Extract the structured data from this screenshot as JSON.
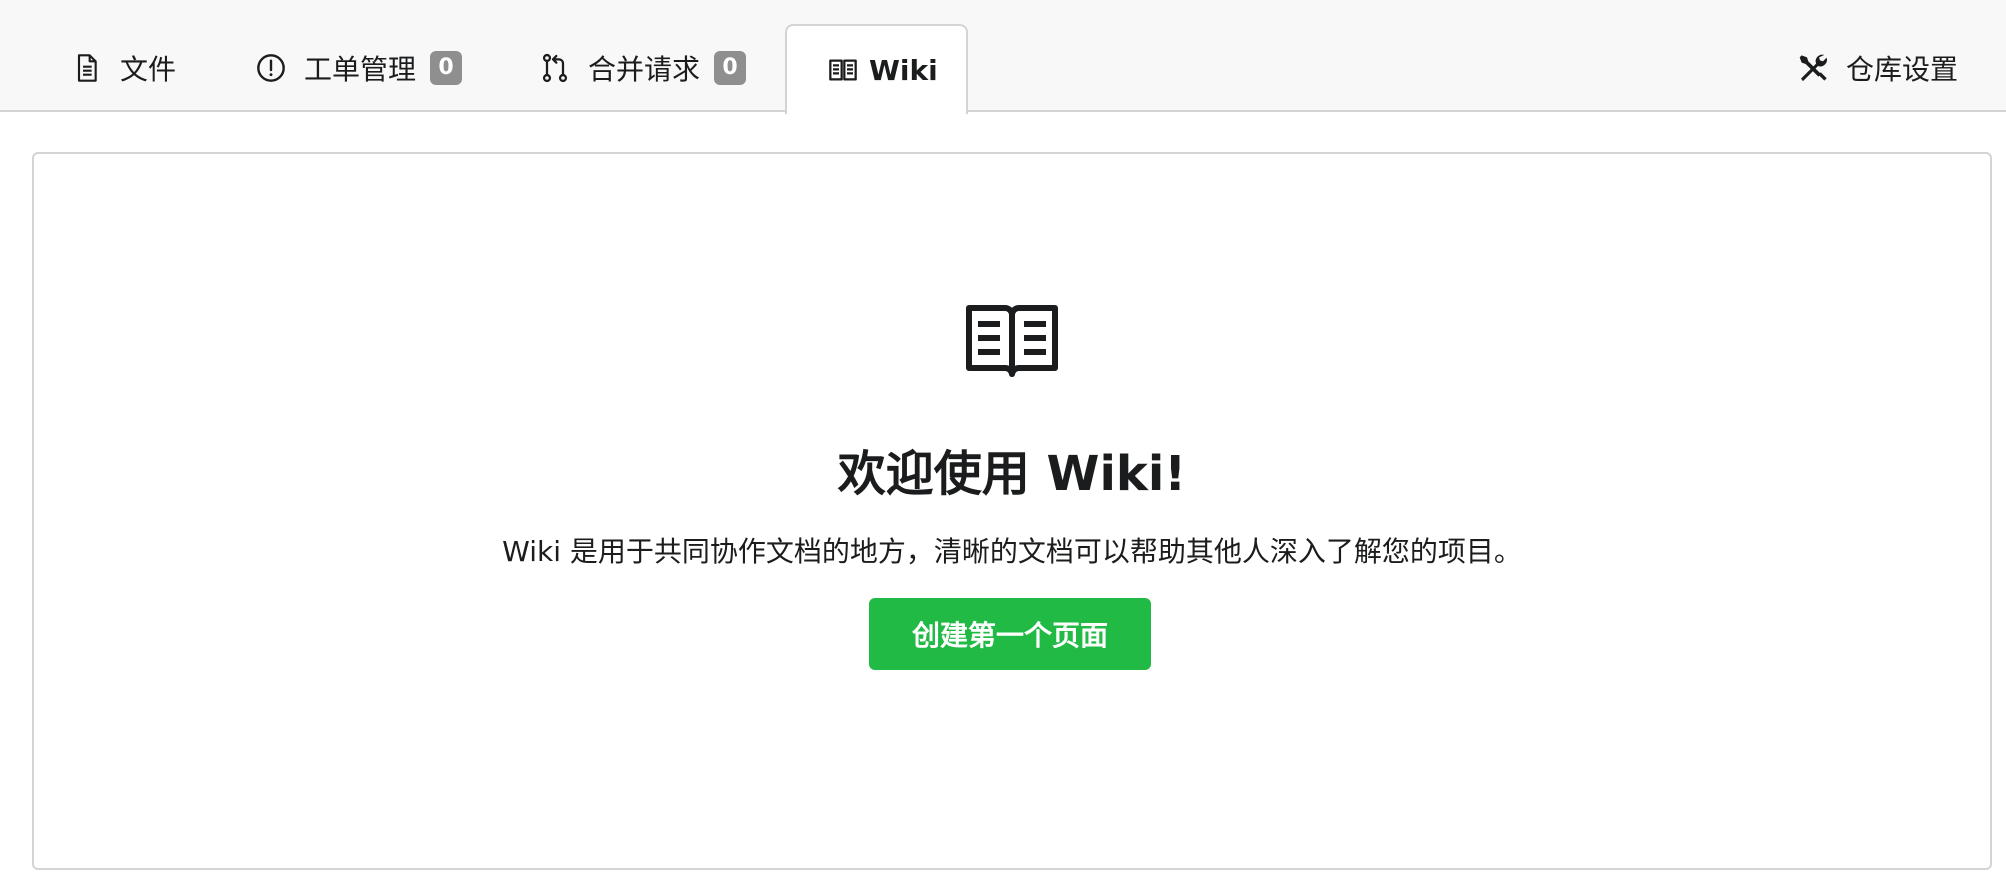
{
  "tabs": [
    {
      "label": "文件",
      "icon": "file-icon"
    },
    {
      "label": "工单管理",
      "icon": "issue-opened-icon",
      "count": "0"
    },
    {
      "label": "合并请求",
      "icon": "git-pull-request-icon",
      "count": "0"
    },
    {
      "label": "Wiki",
      "icon": "book-icon",
      "active": true
    },
    {
      "label": "仓库设置",
      "icon": "tools-icon"
    }
  ],
  "empty_state": {
    "icon": "book-icon",
    "title": "欢迎使用 Wiki!",
    "description": "Wiki 是用于共同协作文档的地方，清晰的文档可以帮助其他人深入了解您的项目。",
    "button_label": "创建第一个页面"
  },
  "colors": {
    "primary_button": "#21ba45",
    "badge": "#8f8f8f",
    "tabbar_bg": "#f8f8f8",
    "border": "#d4d4d5"
  }
}
